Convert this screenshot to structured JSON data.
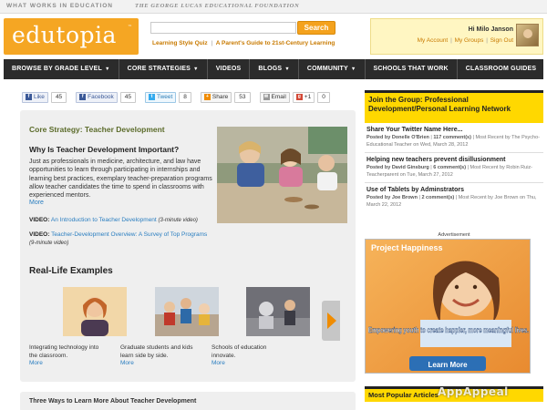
{
  "top_strip": {
    "tagline": "WHAT WORKS IN EDUCATION",
    "foundation": "THE GEORGE LUCAS EDUCATIONAL FOUNDATION"
  },
  "header": {
    "logo_text": "edutopia",
    "logo_mark": "™",
    "search": {
      "value": "",
      "button": "Search"
    },
    "links": [
      "Learning Style Quiz",
      "A Parent's Guide to 21st-Century Learning"
    ],
    "link_separator": "|",
    "user": {
      "greeting": "Hi Milo Janson",
      "links": [
        "My Account",
        "My Groups",
        "Sign Out"
      ],
      "separator": "|"
    }
  },
  "nav": {
    "items": [
      {
        "label": "BROWSE BY GRADE LEVEL",
        "caret": "▼"
      },
      {
        "label": "CORE STRATEGIES",
        "caret": "▼"
      },
      {
        "label": "VIDEOS",
        "caret": ""
      },
      {
        "label": "BLOGS",
        "caret": "▼"
      },
      {
        "label": "COMMUNITY",
        "caret": "▼"
      },
      {
        "label": "SCHOOLS THAT WORK",
        "caret": ""
      },
      {
        "label": "CLASSROOM GUIDES",
        "caret": ""
      }
    ]
  },
  "share": {
    "like": {
      "label": "Like",
      "count": "45"
    },
    "facebook": {
      "label": "Facebook",
      "count": "45"
    },
    "tweet": {
      "label": "Tweet",
      "count": "8"
    },
    "share": {
      "label": "Share",
      "count": "53"
    },
    "email": {
      "label": "Email"
    },
    "plusone": {
      "label": "+1",
      "count": "0"
    }
  },
  "main": {
    "strategy_title": "Core Strategy: Teacher Development",
    "why_heading": "Why Is Teacher Development Important?",
    "why_body": "Just as professionals in medicine, architecture, and law have opportunities to learn through participating in internships and learning best practices, exemplary teacher-preparation programs allow teacher candidates the time to spend in classrooms with experienced mentors.",
    "more": "More",
    "videos": [
      {
        "label": "VIDEO:",
        "link": "An Introduction to Teacher Development",
        "note": "(3-minute video)"
      },
      {
        "label": "VIDEO:",
        "link": "Teacher-Development Overview: A Survey of Top Programs",
        "note": "(9-minute video)"
      }
    ],
    "real_life_heading": "Real-Life Examples",
    "examples": [
      {
        "caption": "Integrating technology into the classroom.",
        "more": "More"
      },
      {
        "caption": "Graduate students and kids learn side by side.",
        "more": "More"
      },
      {
        "caption": "Schools of education innovate.",
        "more": "More"
      }
    ],
    "three_ways": "Three Ways to Learn More About Teacher Development"
  },
  "right": {
    "join_group": "Join the Group: Professional Development/Personal Learning Network",
    "posts": [
      {
        "title": "Share Your Twitter Name Here...",
        "by_label": "Posted by",
        "author": "Donelle O'Brien",
        "comments": "117 comment(s)",
        "recent": "Most Recent by The Psycho-Educational Teacher on Wed, March 28, 2012"
      },
      {
        "title": "Helping new teachers prevent disillusionment",
        "by_label": "Posted by",
        "author": "David Ginsburg",
        "comments": "6 comment(s)",
        "recent": "Most Recent by Robin Ruiz- Teacherparent on Tue, March 27, 2012"
      },
      {
        "title": "Use of Tablets by Adminstrators",
        "by_label": "Posted by",
        "author": "Joe Brown",
        "comments": "2 comment(s)",
        "recent": "Most Recent by Joe Brown on Thu, March 22, 2012"
      }
    ],
    "ad_label": "Advertisement",
    "ad": {
      "brand": "Project Happiness",
      "headline": "Empowering youth to create happier, more meaningful lives.",
      "button": "Learn More"
    },
    "most_popular": "Most Popular Articles"
  },
  "watermark": "AppAppeal",
  "colors": {
    "brand_orange": "#f5a623",
    "nav_bg": "#2b2b2b",
    "accent_yellow": "#ffd800",
    "link_blue": "#2a7ec0",
    "strategy_green": "#5b6b2a"
  }
}
